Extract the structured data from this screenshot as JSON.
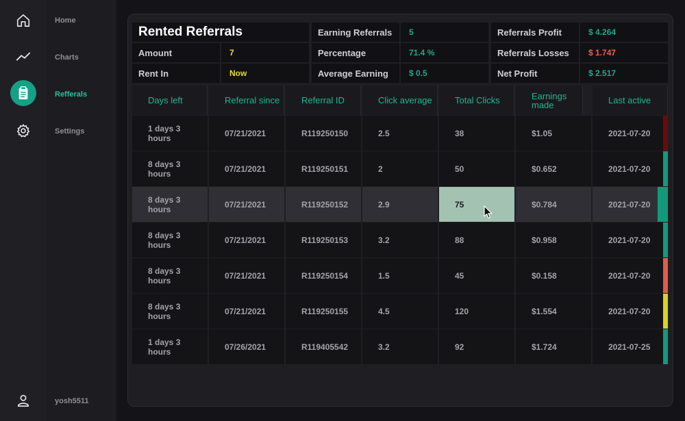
{
  "nav": [
    {
      "label": "Home",
      "icon": "home-icon",
      "active": false
    },
    {
      "label": "Charts",
      "icon": "chart-line-icon",
      "active": false
    },
    {
      "label": "Refferals",
      "icon": "clipboard-icon",
      "active": true
    },
    {
      "label": "Settings",
      "icon": "gear-icon",
      "active": false
    }
  ],
  "user": {
    "name": "yosh5511",
    "icon": "user-icon"
  },
  "summary": {
    "title": "Rented Referrals",
    "amount_label": "Amount",
    "amount_value": "7",
    "rent_in_label": "Rent In",
    "rent_in_value": "Now",
    "earning_referrals_label": "Earning Referrals",
    "earning_referrals_value": "5",
    "percentage_label": "Percentage",
    "percentage_value": "71.4 %",
    "average_earning_label": "Average Earning",
    "average_earning_value": "$ 0.5",
    "referrals_profit_label": "Referrals Profit",
    "referrals_profit_value": "$ 4.264",
    "referrals_losses_label": "Referrals Losses",
    "referrals_losses_value": "$ 1.747",
    "net_profit_label": "Net Profit",
    "net_profit_value": "$ 2.517"
  },
  "table": {
    "headers": [
      "Days left",
      "Referral since",
      "Referral ID",
      "Click average",
      "Total Clicks",
      "Earnings made",
      "Last active"
    ],
    "rows": [
      {
        "days_left": "1 days 3 hours",
        "since": "07/21/2021",
        "id": "R119250150",
        "click_avg": "2.5",
        "total_clicks": "38",
        "earnings": "$1.05",
        "last_active": "2021-07-20",
        "status_color": "#6b0a0a"
      },
      {
        "days_left": "8 days 3 hours",
        "since": "07/21/2021",
        "id": "R119250151",
        "click_avg": "2",
        "total_clicks": "50",
        "earnings": "$0.652",
        "last_active": "2021-07-20",
        "status_color": "#139a7a"
      },
      {
        "days_left": "8 days 3 hours",
        "since": "07/21/2021",
        "id": "R119250152",
        "click_avg": "2.9",
        "total_clicks": "75",
        "earnings": "$0.784",
        "last_active": "2021-07-20",
        "status_color": "#139a7a",
        "selected": true
      },
      {
        "days_left": "8 days 3 hours",
        "since": "07/21/2021",
        "id": "R119250153",
        "click_avg": "3.2",
        "total_clicks": "88",
        "earnings": "$0.958",
        "last_active": "2021-07-20",
        "status_color": "#139a7a"
      },
      {
        "days_left": "8 days 3 hours",
        "since": "07/21/2021",
        "id": "R119250154",
        "click_avg": "1.5",
        "total_clicks": "45",
        "earnings": "$0.158",
        "last_active": "2021-07-20",
        "status_color": "#e05c4c"
      },
      {
        "days_left": "8 days 3 hours",
        "since": "07/21/2021",
        "id": "R119250155",
        "click_avg": "4.5",
        "total_clicks": "120",
        "earnings": "$1.554",
        "last_active": "2021-07-20",
        "status_color": "#d8d224"
      },
      {
        "days_left": "1 days 3 hours",
        "since": "07/26/2021",
        "id": "R119405542",
        "click_avg": "3.2",
        "total_clicks": "92",
        "earnings": "$1.724",
        "last_active": "2021-07-25",
        "status_color": "#139a7a"
      }
    ]
  },
  "colors": {
    "accent": "#16a085",
    "highlight": "#a4c2b2"
  }
}
